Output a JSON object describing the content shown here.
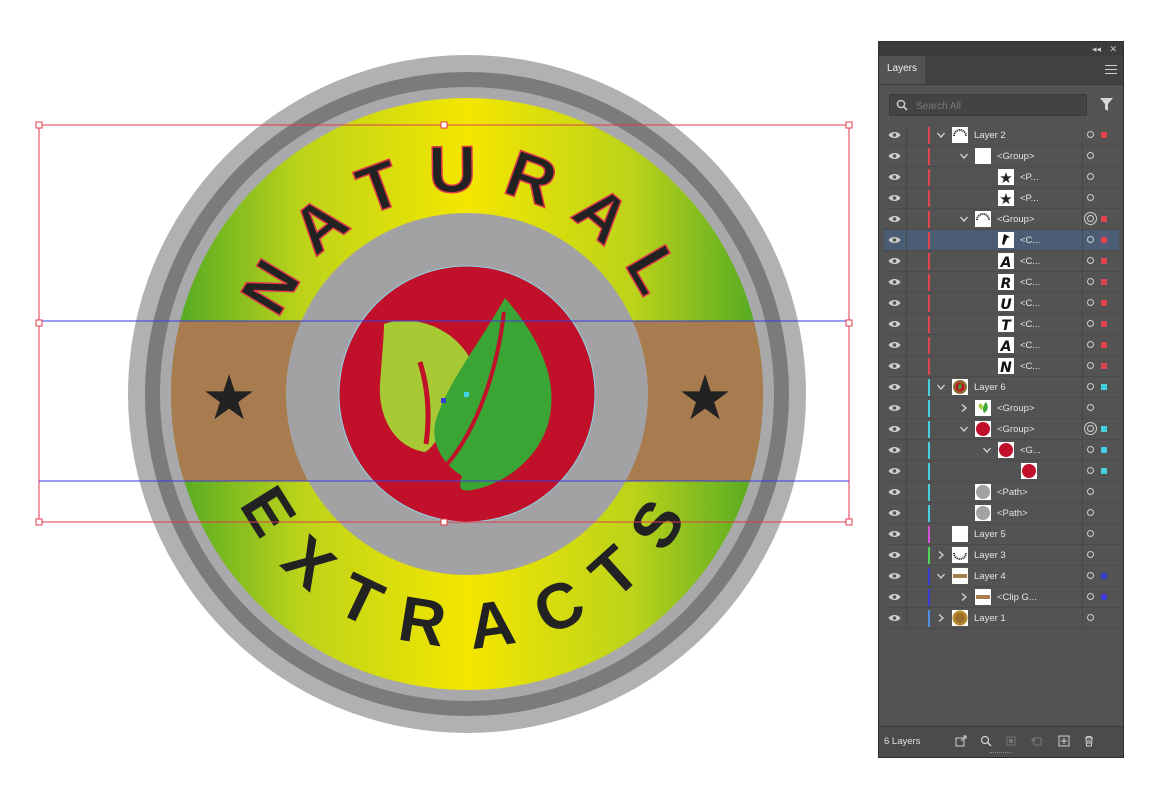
{
  "artwork": {
    "top_text": "NATURAL",
    "bottom_text": "EXTRACTS",
    "colors": {
      "outer_ring": "#b1b1b3",
      "dark_ring": "#7b7b7d",
      "gradient_yellow": "#f4e600",
      "gradient_green": "#4fa824",
      "band": "#a87c4e",
      "inner_ring": "#a2a2a4",
      "red_circle": "#c0102a",
      "leaf_light": "#a7c934",
      "leaf_dark": "#3aa534",
      "selection_red": "#e03a4a",
      "guide_blue": "#3a3adf",
      "text_dark": "#222222"
    }
  },
  "panel": {
    "tab_label": "Layers",
    "search_placeholder": "Search All",
    "footer_count": "6 Layers",
    "rows": [
      {
        "name": "Layer 2",
        "indent": 0,
        "twist": "down",
        "bar": "#e0444e",
        "thumb": "badge-top",
        "target": "ring",
        "sq": "#e0444e",
        "selected": false
      },
      {
        "name": "<Group>",
        "indent": 1,
        "twist": "down",
        "bar": "#e0444e",
        "thumb": "blank",
        "target": "ring",
        "sq": "",
        "selected": false
      },
      {
        "name": "<P...",
        "indent": 2,
        "twist": "",
        "bar": "#e0444e",
        "thumb": "star",
        "target": "ring",
        "sq": "",
        "selected": false
      },
      {
        "name": "<P...",
        "indent": 2,
        "twist": "",
        "bar": "#e0444e",
        "thumb": "star",
        "target": "ring",
        "sq": "",
        "selected": false
      },
      {
        "name": "<Group>",
        "indent": 1,
        "twist": "down",
        "bar": "#e0444e",
        "thumb": "arc",
        "target": "ring2",
        "sq": "#e0444e",
        "selected": false
      },
      {
        "name": "<C...",
        "indent": 2,
        "twist": "",
        "bar": "#e0444e",
        "thumb": "L",
        "target": "ring",
        "sq": "#e0444e",
        "selected": true
      },
      {
        "name": "<C...",
        "indent": 2,
        "twist": "",
        "bar": "#e0444e",
        "thumb": "A",
        "target": "ring",
        "sq": "#e0444e",
        "selected": false
      },
      {
        "name": "<C...",
        "indent": 2,
        "twist": "",
        "bar": "#e0444e",
        "thumb": "R",
        "target": "ring",
        "sq": "#e0444e",
        "selected": false
      },
      {
        "name": "<C...",
        "indent": 2,
        "twist": "",
        "bar": "#e0444e",
        "thumb": "U",
        "target": "ring",
        "sq": "#e0444e",
        "selected": false
      },
      {
        "name": "<C...",
        "indent": 2,
        "twist": "",
        "bar": "#e0444e",
        "thumb": "T",
        "target": "ring",
        "sq": "#e0444e",
        "selected": false
      },
      {
        "name": "<C...",
        "indent": 2,
        "twist": "",
        "bar": "#e0444e",
        "thumb": "A",
        "target": "ring",
        "sq": "#e0444e",
        "selected": false
      },
      {
        "name": "<C...",
        "indent": 2,
        "twist": "",
        "bar": "#e0444e",
        "thumb": "N",
        "target": "ring",
        "sq": "#e0444e",
        "selected": false
      },
      {
        "name": "Layer 6",
        "indent": 0,
        "twist": "down",
        "bar": "#45d0e0",
        "thumb": "emblem",
        "target": "ring",
        "sq": "#45d0e0",
        "selected": false
      },
      {
        "name": "<Group>",
        "indent": 1,
        "twist": "right",
        "bar": "#45d0e0",
        "thumb": "leaf",
        "target": "ring",
        "sq": "",
        "selected": false
      },
      {
        "name": "<Group>",
        "indent": 1,
        "twist": "down",
        "bar": "#45d0e0",
        "thumb": "redcircle",
        "target": "ring2",
        "sq": "#45d0e0",
        "selected": false
      },
      {
        "name": "<G...",
        "indent": 2,
        "twist": "down",
        "bar": "#45d0e0",
        "thumb": "redcircle",
        "target": "ring",
        "sq": "#45d0e0",
        "selected": false
      },
      {
        "name": "",
        "indent": 3,
        "twist": "",
        "bar": "#45d0e0",
        "thumb": "redcircle",
        "target": "ring",
        "sq": "#45d0e0",
        "selected": false
      },
      {
        "name": "<Path>",
        "indent": 1,
        "twist": "",
        "bar": "#45d0e0",
        "thumb": "graycircle",
        "target": "ring",
        "sq": "",
        "selected": false
      },
      {
        "name": "<Path>",
        "indent": 1,
        "twist": "",
        "bar": "#45d0e0",
        "thumb": "graycircle",
        "target": "ring",
        "sq": "",
        "selected": false
      },
      {
        "name": "Layer 5",
        "indent": 0,
        "twist": "",
        "bar": "#d24fd6",
        "thumb": "blank",
        "target": "ring",
        "sq": "",
        "selected": false
      },
      {
        "name": "Layer 3",
        "indent": 0,
        "twist": "right",
        "bar": "#4fd65a",
        "thumb": "arcbottom",
        "target": "ring",
        "sq": "",
        "selected": false
      },
      {
        "name": "Layer 4",
        "indent": 0,
        "twist": "down",
        "bar": "#3b3bd6",
        "thumb": "band",
        "target": "ring",
        "sq": "#3b3bd6",
        "selected": false
      },
      {
        "name": "<Clip G...",
        "indent": 1,
        "twist": "right",
        "bar": "#3b3bd6",
        "thumb": "band",
        "target": "ring",
        "sq": "#3b3bd6",
        "selected": false
      },
      {
        "name": "Layer 1",
        "indent": 0,
        "twist": "right",
        "bar": "#4f8de0",
        "thumb": "goldcircle",
        "target": "ring",
        "sq": "",
        "selected": false
      }
    ]
  }
}
